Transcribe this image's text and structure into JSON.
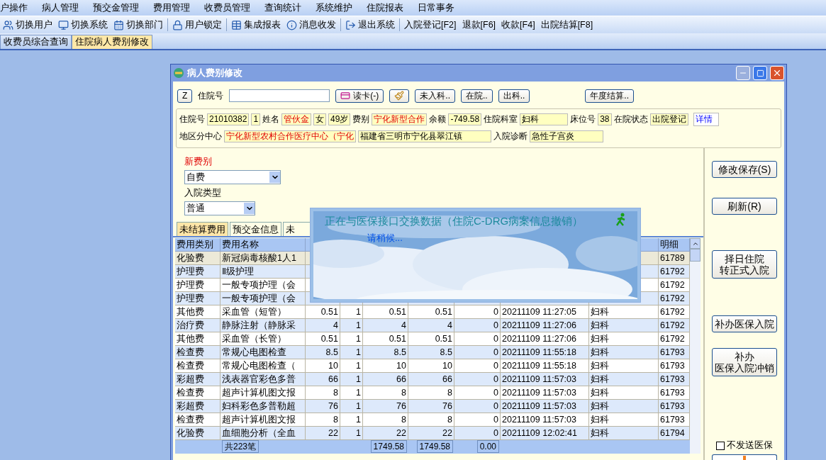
{
  "menu": [
    "户操作",
    "病人管理",
    "预交金管理",
    "费用管理",
    "收费员管理",
    "查询统计",
    "系统维护",
    "住院报表",
    "日常事务"
  ],
  "toolbar": [
    {
      "label": "切换用户",
      "separator_before": false
    },
    {
      "label": "切换系统",
      "separator_before": false
    },
    {
      "label": "切换部门",
      "separator_before": false
    },
    {
      "label": "用户锁定",
      "separator_before": true
    },
    {
      "label": "集成报表",
      "separator_before": true
    },
    {
      "label": "消息收发",
      "separator_before": false
    },
    {
      "label": "退出系统",
      "separator_before": true
    },
    {
      "label": "入院登记[F2]",
      "separator_before": true
    },
    {
      "label": "退款[F6]",
      "separator_before": false
    },
    {
      "label": "收款[F4]",
      "separator_before": false
    },
    {
      "label": "出院结算[F8]",
      "separator_before": false
    }
  ],
  "doc_tabs": [
    {
      "label": "收费员综合查询",
      "selected": false
    },
    {
      "label": "住院病人费别修改",
      "selected": true
    }
  ],
  "window": {
    "title": "病人费别修改",
    "minimize_disabled": true
  },
  "search": {
    "z_key": "Z",
    "label": "住院号",
    "buttons": [
      {
        "kind": "card",
        "label": "读卡(-)"
      },
      {
        "kind": "broom"
      },
      {
        "kind": "text",
        "label": "未入科.."
      },
      {
        "kind": "text",
        "label": "在院.."
      },
      {
        "kind": "text",
        "label": "出科.."
      },
      {
        "kind": "gap"
      },
      {
        "kind": "text",
        "label": "年度结算.."
      }
    ]
  },
  "info_rows": [
    [
      {
        "kind": "label",
        "text": "住院号"
      },
      {
        "kind": "field",
        "text": "21010382",
        "emphasis": false
      },
      {
        "kind": "field",
        "text": "1",
        "emphasis": false
      },
      {
        "kind": "label",
        "text": "姓名"
      },
      {
        "kind": "field",
        "text": "管伙金",
        "emphasis": true
      },
      {
        "kind": "field",
        "text": "女",
        "emphasis": false
      },
      {
        "kind": "field",
        "text": "49岁",
        "emphasis": false
      },
      {
        "kind": "label",
        "text": "费别"
      },
      {
        "kind": "field",
        "text": "宁化新型合作",
        "emphasis": true
      },
      {
        "kind": "label",
        "text": "余额"
      },
      {
        "kind": "field",
        "text": "-749.58",
        "emphasis": false
      },
      {
        "kind": "label",
        "text": "住院科室"
      },
      {
        "kind": "field",
        "text": "妇科",
        "emphasis": false,
        "wide": true
      },
      {
        "kind": "label",
        "text": "床位号"
      },
      {
        "kind": "field",
        "text": "38",
        "emphasis": false
      },
      {
        "kind": "label",
        "text": "在院状态"
      },
      {
        "kind": "field",
        "text": "出院登记",
        "emphasis": false
      },
      {
        "kind": "link",
        "text": "详情"
      }
    ],
    [
      {
        "kind": "label",
        "text": "地区分中心"
      },
      {
        "kind": "field",
        "text": "宁化新型农村合作医疗中心（宁化",
        "emphasis": true
      },
      {
        "kind": "field",
        "text": "福建省三明市宁化县翠江镇",
        "emphasis": false,
        "wide": true
      },
      {
        "kind": "label",
        "text": "入院诊断"
      },
      {
        "kind": "field",
        "text": "急性子宫炎",
        "emphasis": false,
        "wide": true
      }
    ]
  ],
  "new_fee_type": {
    "label": "新费别",
    "value": "自费"
  },
  "admission_type": {
    "label": "入院类型",
    "value": "普通"
  },
  "tabs": [
    {
      "label": "未结算费用",
      "selected": true
    },
    {
      "label": "预交金信息",
      "selected": false
    },
    {
      "label": "未",
      "selected": false
    }
  ],
  "table": {
    "columns": [
      "费用类别",
      "费用名称",
      null,
      null,
      null,
      null,
      null,
      null,
      null,
      "明细"
    ],
    "rows": [
      {
        "selected": true,
        "cells": [
          "化验费",
          "新冠病毒核酸1人1",
          null,
          null,
          null,
          null,
          null,
          null,
          null,
          "61789"
        ]
      },
      {
        "selected": false,
        "cells": [
          "护理费",
          "Ⅱ级护理",
          null,
          null,
          null,
          null,
          null,
          null,
          null,
          "61792"
        ]
      },
      {
        "selected": false,
        "cells": [
          "护理费",
          "一般专项护理（会",
          null,
          null,
          null,
          null,
          null,
          null,
          null,
          "61792"
        ]
      },
      {
        "selected": false,
        "cells": [
          "护理费",
          "一般专项护理（会",
          null,
          null,
          null,
          null,
          null,
          null,
          null,
          "61792"
        ]
      },
      {
        "selected": false,
        "cells": [
          "其他费",
          "采血管（短管）",
          "0.51",
          "1",
          "0.51",
          "0.51",
          "0",
          "20211109 11:27:05",
          "妇科",
          "61792"
        ]
      },
      {
        "selected": false,
        "cells": [
          "治疗费",
          "静脉注射（静脉采",
          "4",
          "1",
          "4",
          "4",
          "0",
          "20211109 11:27:06",
          "妇科",
          "61792"
        ]
      },
      {
        "selected": false,
        "cells": [
          "其他费",
          "采血管（长管）",
          "0.51",
          "1",
          "0.51",
          "0.51",
          "0",
          "20211109 11:27:06",
          "妇科",
          "61792"
        ]
      },
      {
        "selected": false,
        "cells": [
          "检查费",
          "常规心电图检查",
          "8.5",
          "1",
          "8.5",
          "8.5",
          "0",
          "20211109 11:55:18",
          "妇科",
          "61793"
        ]
      },
      {
        "selected": false,
        "cells": [
          "检查费",
          "常规心电图检查（",
          "10",
          "1",
          "10",
          "10",
          "0",
          "20211109 11:55:18",
          "妇科",
          "61793"
        ]
      },
      {
        "selected": false,
        "cells": [
          "彩超费",
          "浅表器官彩色多普",
          "66",
          "1",
          "66",
          "66",
          "0",
          "20211109 11:57:03",
          "妇科",
          "61793"
        ]
      },
      {
        "selected": false,
        "cells": [
          "检查费",
          "超声计算机图文报",
          "8",
          "1",
          "8",
          "8",
          "0",
          "20211109 11:57:03",
          "妇科",
          "61793"
        ]
      },
      {
        "selected": false,
        "cells": [
          "彩超费",
          "妇科彩色多普勒超",
          "76",
          "1",
          "76",
          "76",
          "0",
          "20211109 11:57:03",
          "妇科",
          "61793"
        ]
      },
      {
        "selected": false,
        "cells": [
          "检查费",
          "超声计算机图文报",
          "8",
          "1",
          "8",
          "8",
          "0",
          "20211109 11:57:03",
          "妇科",
          "61793"
        ]
      },
      {
        "selected": false,
        "cells": [
          "化验费",
          "血细胞分析（全血",
          "22",
          "1",
          "22",
          "22",
          "0",
          "20211109 12:02:41",
          "妇科",
          "61794"
        ]
      }
    ],
    "footer": {
      "count": "共223笔",
      "totals": [
        "1749.58",
        "1749.58",
        "0.00"
      ]
    }
  },
  "actions": [
    {
      "lines": [
        "修改保存(S)"
      ]
    },
    {
      "lines": [
        "刷新(R)"
      ]
    },
    {
      "lines": [
        "择日住院",
        "转正式入院"
      ]
    },
    {
      "lines": [
        "补办医保入院"
      ]
    },
    {
      "lines": [
        "补办",
        "医保入院冲销"
      ]
    }
  ],
  "no_send_insurance": {
    "label": "不发送医保",
    "checked": false
  },
  "progress": {
    "message": "正在与医保接口交换数据（住院C-DRG病案信息撤销）",
    "hint": "请稍候..."
  }
}
